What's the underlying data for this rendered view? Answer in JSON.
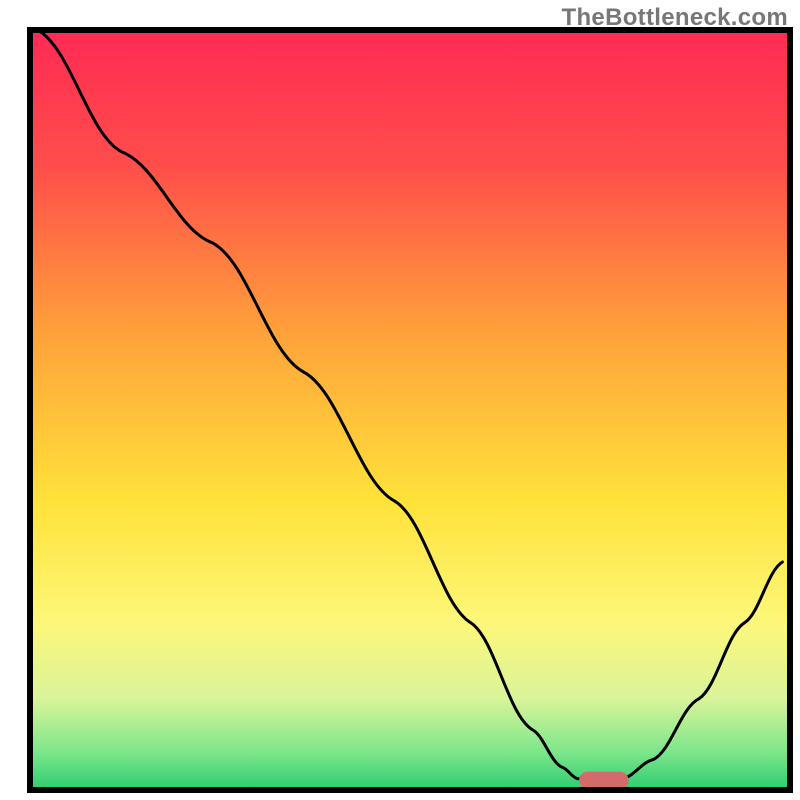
{
  "watermark": "TheBottleneck.com",
  "chart_data": {
    "type": "line",
    "title": "",
    "xlabel": "",
    "ylabel": "",
    "xlim": [
      0,
      100
    ],
    "ylim": [
      0,
      100
    ],
    "gradient_stops": [
      {
        "offset": 0,
        "color": "#ff2a55"
      },
      {
        "offset": 18,
        "color": "#ff4e4a"
      },
      {
        "offset": 40,
        "color": "#ffa23a"
      },
      {
        "offset": 62,
        "color": "#ffe23a"
      },
      {
        "offset": 78,
        "color": "#fdf77a"
      },
      {
        "offset": 88,
        "color": "#d9f49a"
      },
      {
        "offset": 95,
        "color": "#7de68a"
      },
      {
        "offset": 100,
        "color": "#2ecc71"
      }
    ],
    "curve_points": [
      {
        "x": 1,
        "y": 100
      },
      {
        "x": 12,
        "y": 84
      },
      {
        "x": 24,
        "y": 72
      },
      {
        "x": 36,
        "y": 55
      },
      {
        "x": 48,
        "y": 38
      },
      {
        "x": 58,
        "y": 22
      },
      {
        "x": 66,
        "y": 8
      },
      {
        "x": 70,
        "y": 3
      },
      {
        "x": 72,
        "y": 1.5
      },
      {
        "x": 75,
        "y": 1.2
      },
      {
        "x": 78,
        "y": 1.5
      },
      {
        "x": 82,
        "y": 4
      },
      {
        "x": 88,
        "y": 12
      },
      {
        "x": 94,
        "y": 22
      },
      {
        "x": 99,
        "y": 30
      }
    ],
    "marker": {
      "x": 75.5,
      "y": 1.3,
      "color": "#d46a6a",
      "width": 6.5,
      "height": 2.2
    },
    "axis_color": "#000000",
    "line_color": "#000000"
  }
}
